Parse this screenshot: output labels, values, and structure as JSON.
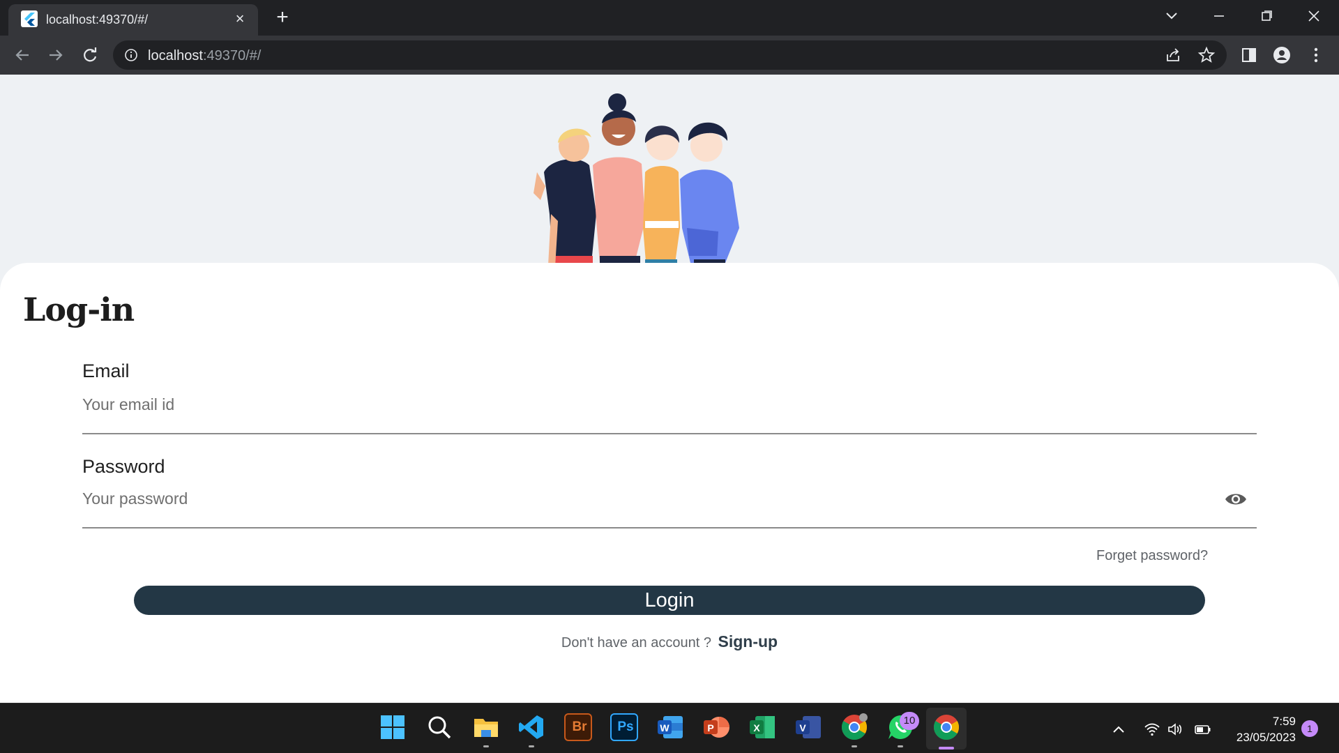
{
  "browser": {
    "tab_title": "localhost:49370/#/",
    "url_host": "localhost",
    "url_path": ":49370/#/"
  },
  "page": {
    "title": "Log-in",
    "email_label": "Email",
    "email_placeholder": "Your email id",
    "password_label": "Password",
    "password_placeholder": "Your password",
    "forget_password": "Forget password?",
    "login_button": "Login",
    "signup_prompt": "Don't have an account ?",
    "signup_link": "Sign-up"
  },
  "taskbar": {
    "apps": [
      "windows-start",
      "search",
      "file-explorer",
      "vs-code",
      "adobe-bridge",
      "photoshop",
      "word",
      "powerpoint",
      "excel",
      "visio",
      "chrome",
      "whatsapp",
      "chrome-active"
    ],
    "whatsapp_badge": "10",
    "time": "7:59",
    "date": "23/05/2023",
    "notification_count": "1"
  },
  "colors": {
    "login_button": "#233745",
    "page_background": "#eef1f4",
    "accent": "#c58af9"
  }
}
